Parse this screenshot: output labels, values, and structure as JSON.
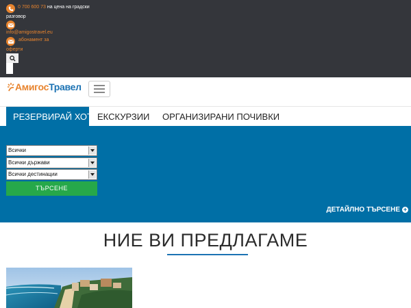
{
  "topbar": {
    "phone": "0 700 600 73",
    "phone_note": "на цена на градски",
    "phone_note_wrap": "разговор",
    "email": "info@amigostravel.eu",
    "subscribe_line1": "абонамент за",
    "subscribe_line2": "оферти",
    "icons": {
      "phone": "phone-icon",
      "email": "envelope-icon",
      "subscribe": "envelope-icon",
      "search": "search-icon"
    },
    "accent_color": "#e8842e",
    "background": "#34363b"
  },
  "nav": {
    "logo_part1": "Амигос",
    "logo_part2": "Травел",
    "menu_icon": "hamburger-icon"
  },
  "tabs": [
    {
      "label": "РЕЗЕРВИРАЙ ХОТЕЛ",
      "active": true
    },
    {
      "label": "ЕКСКУРЗИИ",
      "active": false
    },
    {
      "label": "ОРГАНИЗИРАНИ ПОЧИВКИ",
      "active": false
    }
  ],
  "search": {
    "select1": "Всички",
    "select2": "Всички държави",
    "select3": "Всички дестинации",
    "submit_label": "ТЪРСЕНЕ",
    "advanced_label": "ДЕТАЙЛНО ТЪРСЕНЕ",
    "panel_color": "#006fa6",
    "button_color": "#26a84a"
  },
  "main": {
    "heading": "НИЕ ВИ ПРЕДЛАГАМЕ"
  }
}
